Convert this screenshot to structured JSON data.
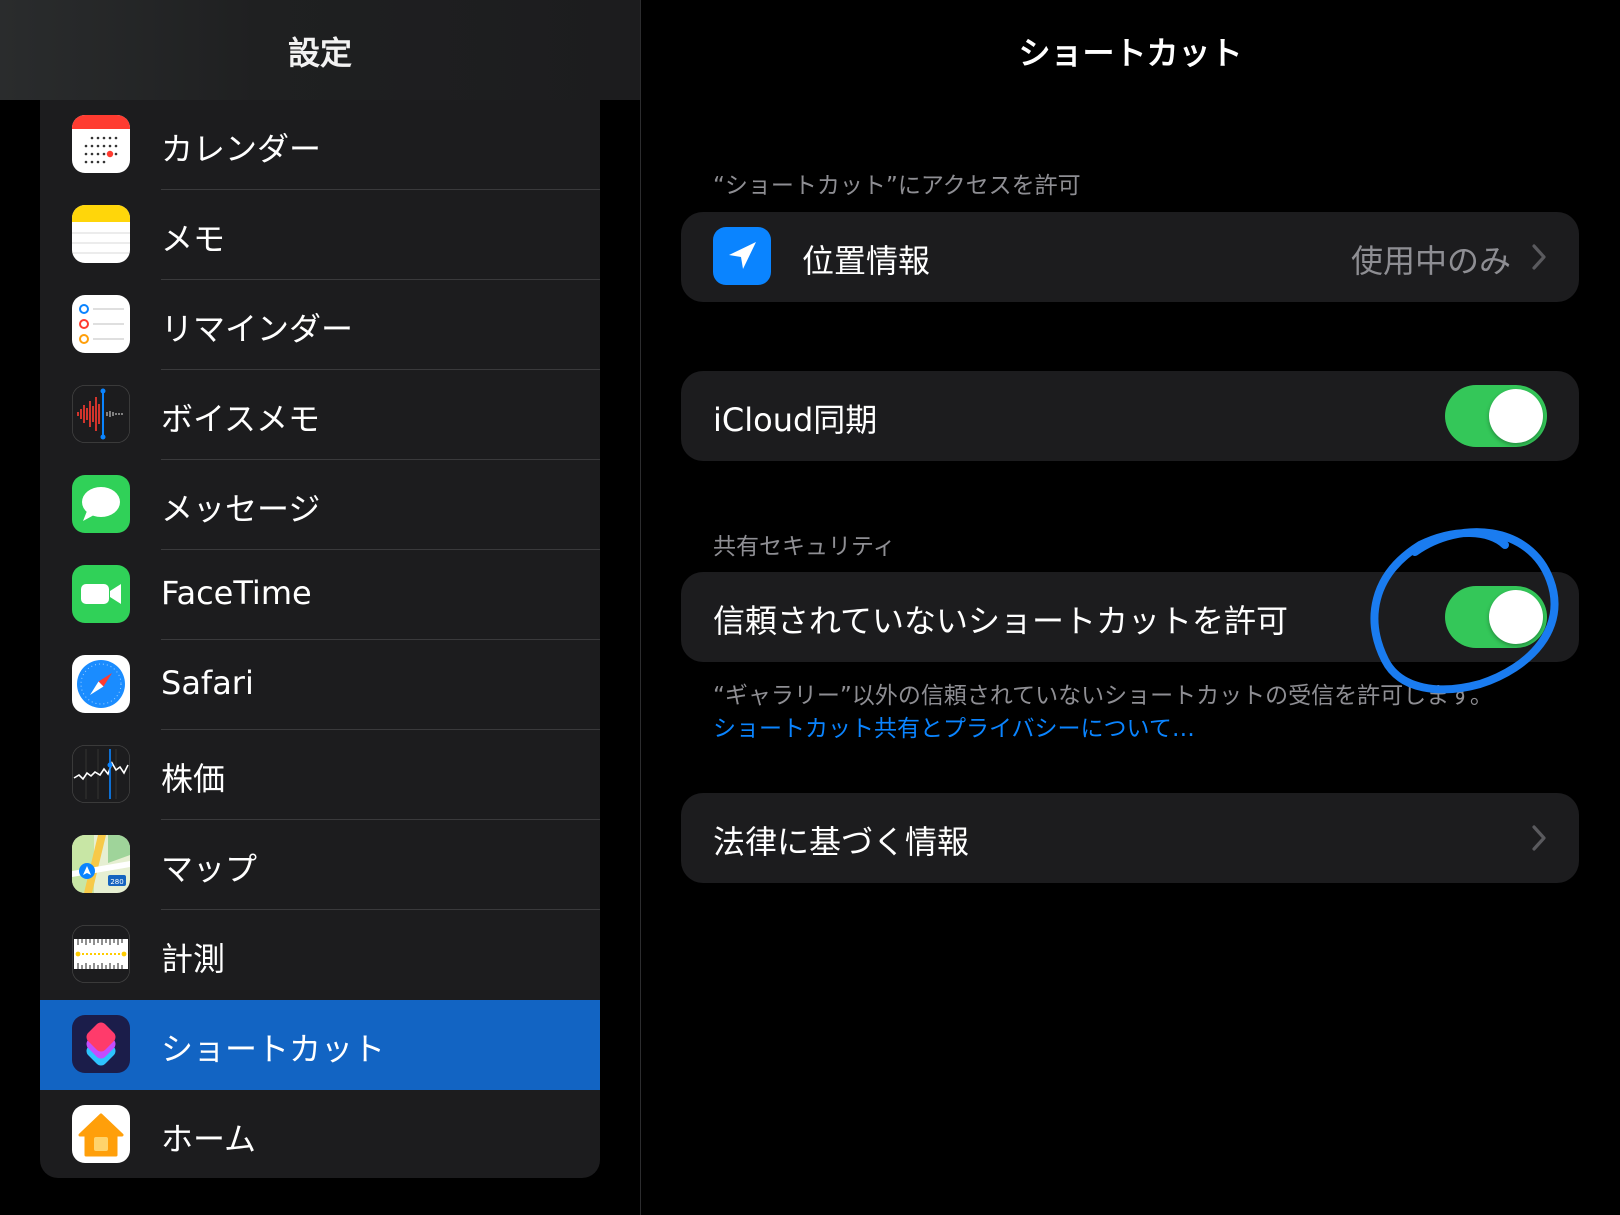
{
  "sidebar": {
    "title": "設定",
    "items": [
      {
        "label": "カレンダー",
        "icon": "calendar-icon"
      },
      {
        "label": "メモ",
        "icon": "notes-icon"
      },
      {
        "label": "リマインダー",
        "icon": "reminders-icon"
      },
      {
        "label": "ボイスメモ",
        "icon": "voice-memos-icon"
      },
      {
        "label": "メッセージ",
        "icon": "messages-icon"
      },
      {
        "label": "FaceTime",
        "icon": "facetime-icon"
      },
      {
        "label": "Safari",
        "icon": "safari-icon"
      },
      {
        "label": "株価",
        "icon": "stocks-icon"
      },
      {
        "label": "マップ",
        "icon": "maps-icon"
      },
      {
        "label": "計測",
        "icon": "measure-icon"
      },
      {
        "label": "ショートカット",
        "icon": "shortcuts-icon",
        "selected": true
      },
      {
        "label": "ホーム",
        "icon": "home-icon"
      }
    ]
  },
  "detail": {
    "title": "ショートカット",
    "access_header": "“ショートカット”にアクセスを許可",
    "location": {
      "label": "位置情報",
      "value": "使用中のみ",
      "icon": "location-arrow-icon"
    },
    "icloud_sync": {
      "label": "iCloud同期",
      "on": true
    },
    "security_header": "共有セキュリティ",
    "untrusted": {
      "label": "信頼されていないショートカットを許可",
      "on": true
    },
    "footer_note": "“ギャラリー”以外の信頼されていないショートカットの受信を許可します。",
    "footer_link": "ショートカット共有とプライバシーについて…",
    "legal": {
      "label": "法律に基づく情報"
    }
  },
  "colors": {
    "accent": "#0a84ff",
    "selection": "#1264c3",
    "toggle_on": "#34c759",
    "annotation": "#1a7cf0"
  }
}
